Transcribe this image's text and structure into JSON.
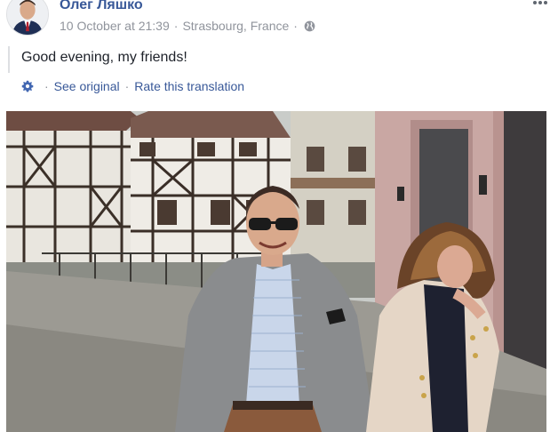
{
  "post": {
    "author": "Олег Ляшко",
    "timestamp": "10 October at 21:39",
    "location": "Strasbourg, France",
    "separator": "·",
    "privacy_icon": "globe-icon",
    "more_icon": "more-icon",
    "text": "Good evening, my friends!",
    "translation": {
      "icon": "gear-icon",
      "see_original": "See original",
      "rate": "Rate this translation",
      "separator": "·"
    }
  },
  "colors": {
    "link": "#385898",
    "meta": "#90949c",
    "text": "#1d2129"
  }
}
